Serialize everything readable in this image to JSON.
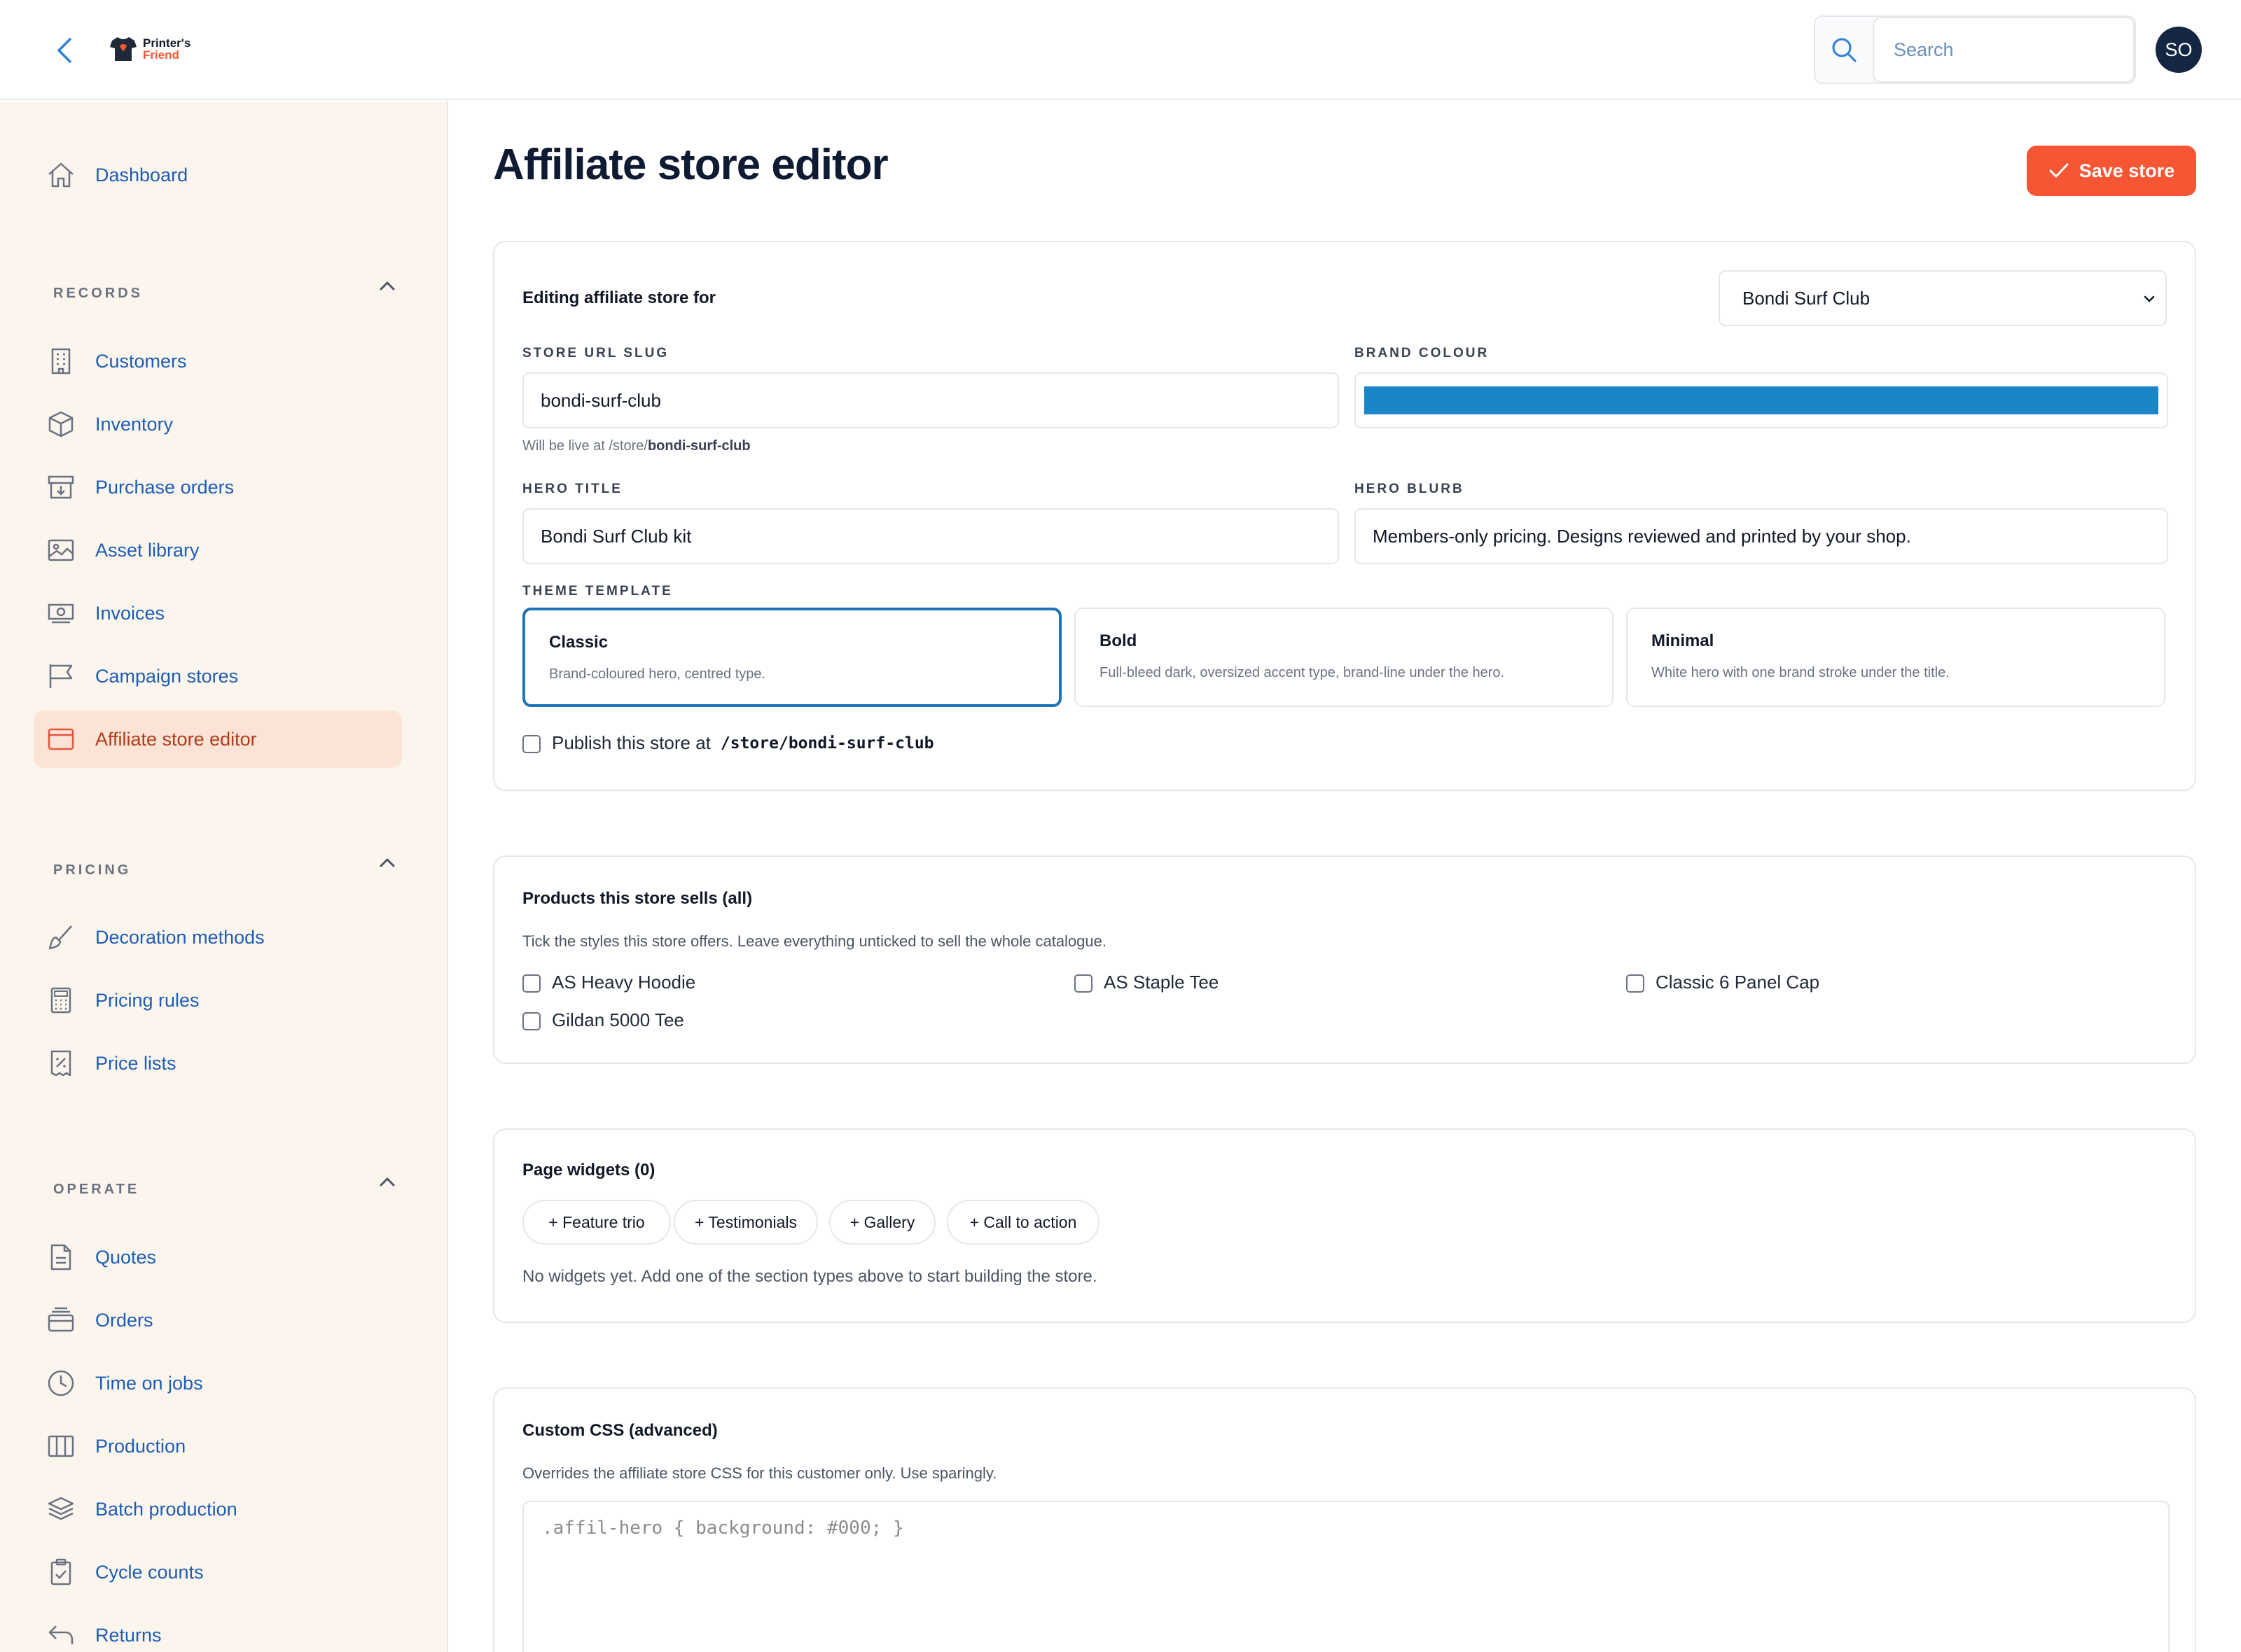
{
  "brand": {
    "line1": "Printer's",
    "line2": "Friend"
  },
  "header": {
    "search_placeholder": "Search",
    "avatar_initials": "SO"
  },
  "sidebar": {
    "dashboard": "Dashboard",
    "records_label": "RECORDS",
    "records": [
      "Customers",
      "Inventory",
      "Purchase orders",
      "Asset library",
      "Invoices",
      "Campaign stores",
      "Affiliate store editor"
    ],
    "pricing_label": "PRICING",
    "pricing": [
      "Decoration methods",
      "Pricing rules",
      "Price lists"
    ],
    "operate_label": "OPERATE",
    "operate": [
      "Quotes",
      "Orders",
      "Time on jobs",
      "Production",
      "Batch production",
      "Cycle counts",
      "Returns"
    ],
    "active_item": "Affiliate store editor"
  },
  "page": {
    "title": "Affiliate store editor",
    "save_label": "Save store"
  },
  "store_card": {
    "editing_label": "Editing affiliate store for",
    "customer_selected": "Bondi Surf Club",
    "slug_label": "STORE URL SLUG",
    "slug_value": "bondi-surf-club",
    "slug_hint_prefix": "Will be live at /store/",
    "slug_hint_slug": "bondi-surf-club",
    "brand_colour_label": "BRAND COLOUR",
    "brand_colour": "#1a86c9",
    "hero_title_label": "HERO TITLE",
    "hero_title_value": "Bondi Surf Club kit",
    "hero_blurb_label": "HERO BLURB",
    "hero_blurb_value": "Members-only pricing. Designs reviewed and printed by your shop.",
    "theme_label": "THEME TEMPLATE",
    "themes": [
      {
        "name": "Classic",
        "desc": "Brand-coloured hero, centred type."
      },
      {
        "name": "Bold",
        "desc": "Full-bleed dark, oversized accent type, brand-line under the hero."
      },
      {
        "name": "Minimal",
        "desc": "White hero with one brand stroke under the title."
      }
    ],
    "selected_theme": "Classic",
    "publish_label": "Publish this store at",
    "publish_path": "/store/bondi-surf-club"
  },
  "products_card": {
    "title": "Products this store sells (all)",
    "subtitle": "Tick the styles this store offers. Leave everything unticked to sell the whole catalogue.",
    "products": [
      "AS Heavy Hoodie",
      "AS Staple Tee",
      "Classic 6 Panel Cap",
      "Gildan 5000 Tee"
    ]
  },
  "widgets_card": {
    "title": "Page widgets (0)",
    "buttons": [
      "+ Feature trio",
      "+ Testimonials",
      "+ Gallery",
      "+ Call to action"
    ],
    "empty_text": "No widgets yet. Add one of the section types above to start building the store."
  },
  "css_card": {
    "title": "Custom CSS (advanced)",
    "subtitle": "Overrides the affiliate store CSS for this customer only. Use sparingly.",
    "placeholder": ".affil-hero { background: #000; }"
  },
  "colors": {
    "accent": "#f65634",
    "link": "#1d5db3",
    "navy": "#142642",
    "sidebar_bg": "#fbf5ee",
    "active_bg": "#fbe3d6"
  }
}
